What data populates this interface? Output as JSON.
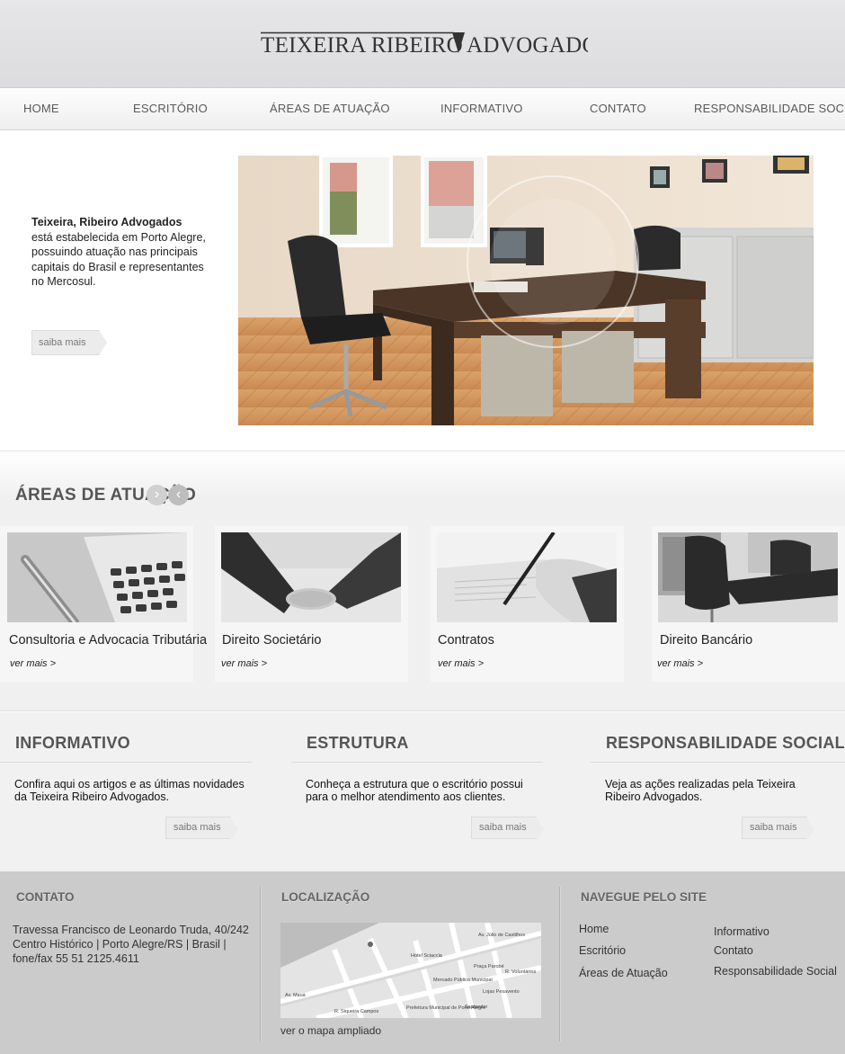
{
  "logo": {
    "text": "TEIXEIRA RIBEIRO ▼ADVOGADOS"
  },
  "nav": {
    "items": [
      {
        "label": "HOME"
      },
      {
        "label": "ESCRITÓRIO"
      },
      {
        "label": "ÁREAS DE ATUAÇÃO"
      },
      {
        "label": "INFORMATIVO"
      },
      {
        "label": "CONTATO"
      },
      {
        "label": "RESPONSABILIDADE SOCIAL"
      }
    ]
  },
  "hero": {
    "title": "Teixeira, Ribeiro Advogados",
    "body": "está estabelecida em Porto Alegre, possuindo atuação nas principais capitais do Brasil e representantes no Mercosul.",
    "button": "saiba mais"
  },
  "areas": {
    "title": "ÁREAS DE ATUAÇÃO",
    "next_icon": "chevron-right-icon",
    "prev_icon": "chevron-left-icon",
    "cards": [
      {
        "title": "Consultoria e Advocacia Tributária",
        "link": "ver mais >"
      },
      {
        "title": "Direito Societário",
        "link": "ver mais >"
      },
      {
        "title": "Contratos",
        "link": "ver mais >"
      },
      {
        "title": "Direito Bancário",
        "link": "ver mais >"
      }
    ]
  },
  "info": {
    "columns": [
      {
        "title": "INFORMATIVO",
        "text": "Confira aqui os artigos e as últimas novidades da Teixeira Ribeiro Advogados.",
        "button": "saiba mais"
      },
      {
        "title": "ESTRUTURA",
        "text": "Conheça a estrutura que o escritório possui para o melhor atendimento aos clientes.",
        "button": "saiba mais"
      },
      {
        "title": "RESPONSABILIDADE SOCIAL",
        "text": "Veja as ações realizadas pela Teixeira Ribeiro Advogados.",
        "button": "saiba mais"
      }
    ]
  },
  "footer": {
    "contact_title": "CONTATO",
    "address_line1": "Travessa Francisco de Leonardo Truda, 40/242",
    "address_line2": "Centro Histórico | Porto Alegre/RS | Brasil |",
    "address_line3": "fone/fax 55 51 2125.4611",
    "location_title": "LOCALIZAÇÃO",
    "map_link": "ver o mapa ampliado",
    "map_labels": [
      "Av. Mauá",
      "Av. Júlio de Castilhos",
      "Praça Parobé",
      "Mercado Público Municipal",
      "Hotel Sciaccia",
      "R. Voluntários",
      "R. Siqueira Campos",
      "Lojas Pesavento",
      "Prefeitura Municipal de Porto Alegre",
      "Santander"
    ],
    "nav_title": "NAVEGUE PELO SITE",
    "nav_links": [
      "Home",
      "Escritório",
      "Áreas de Atuação",
      "Informativo",
      "Contato",
      "Responsabilidade Social"
    ]
  },
  "colors": {
    "header_bg": "#dcdcde",
    "footer_bg": "#cbcbcb",
    "section_bg": "#f1f1f1",
    "heading": "#555555"
  }
}
